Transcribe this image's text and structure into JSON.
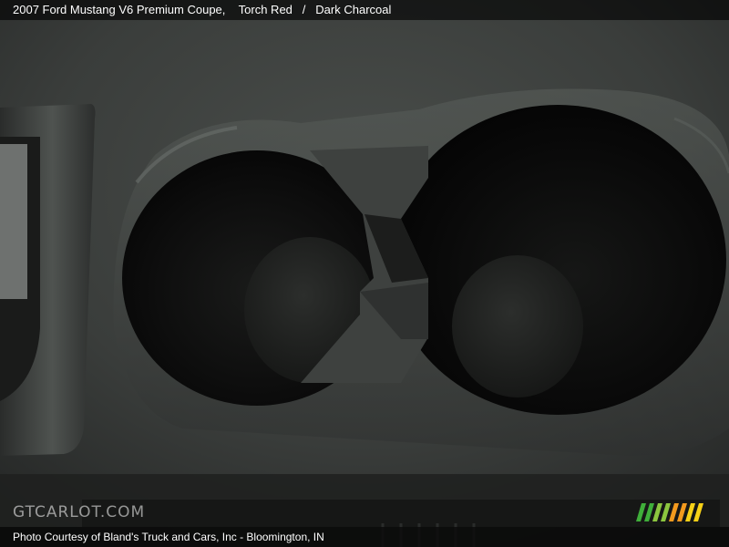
{
  "header": {
    "vehicle": "2007 Ford Mustang V6 Premium Coupe,",
    "color_exterior": "Torch Red",
    "separator": "/",
    "color_interior": "Dark Charcoal"
  },
  "watermark": {
    "text": "GTCARLOT.COM"
  },
  "footer": {
    "credit": "Photo Courtesy of Bland's Truck and Cars, Inc - Bloomington, IN"
  },
  "icons": {
    "stripes": "gtcarlot-stripes-icon"
  },
  "colors": {
    "stripe_green_1": "#3fae3a",
    "stripe_green_2": "#8cc63f",
    "stripe_orange": "#f39a1e",
    "stripe_yellow": "#f7d117",
    "console": "#3b3e3c",
    "cup_well": "#0b0b0b"
  }
}
